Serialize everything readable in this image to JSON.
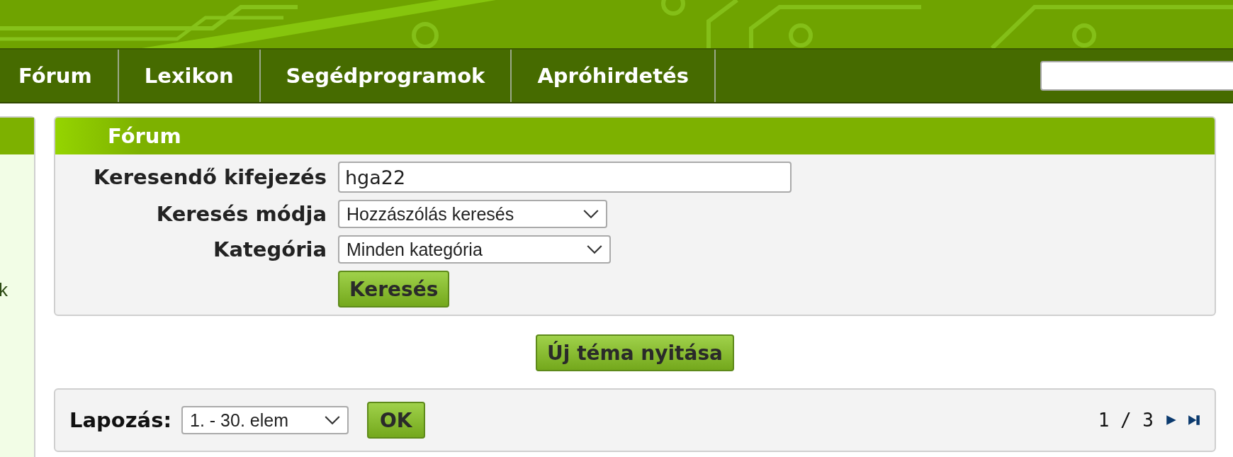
{
  "nav": {
    "items": [
      {
        "label": "Fórum"
      },
      {
        "label": "Lexikon"
      },
      {
        "label": "Segédprogramok"
      },
      {
        "label": "Apróhirdetés"
      }
    ]
  },
  "sidebar": {
    "text": "k"
  },
  "panel": {
    "title": "Fórum",
    "fields": [
      {
        "kind": "text",
        "label": "Keresendő kifejezés",
        "value": "hga22"
      },
      {
        "kind": "select",
        "label": "Keresés módja",
        "value": "Hozzászólás keresés"
      },
      {
        "kind": "select",
        "label": "Kategória",
        "value": "Minden kategória"
      }
    ],
    "submit": "Keresés"
  },
  "new_topic_button": "Új téma nyitása",
  "pager": {
    "label": "Lapozás:",
    "select": "1. - 30. elem",
    "ok": "OK",
    "page": "1 / 3"
  }
}
